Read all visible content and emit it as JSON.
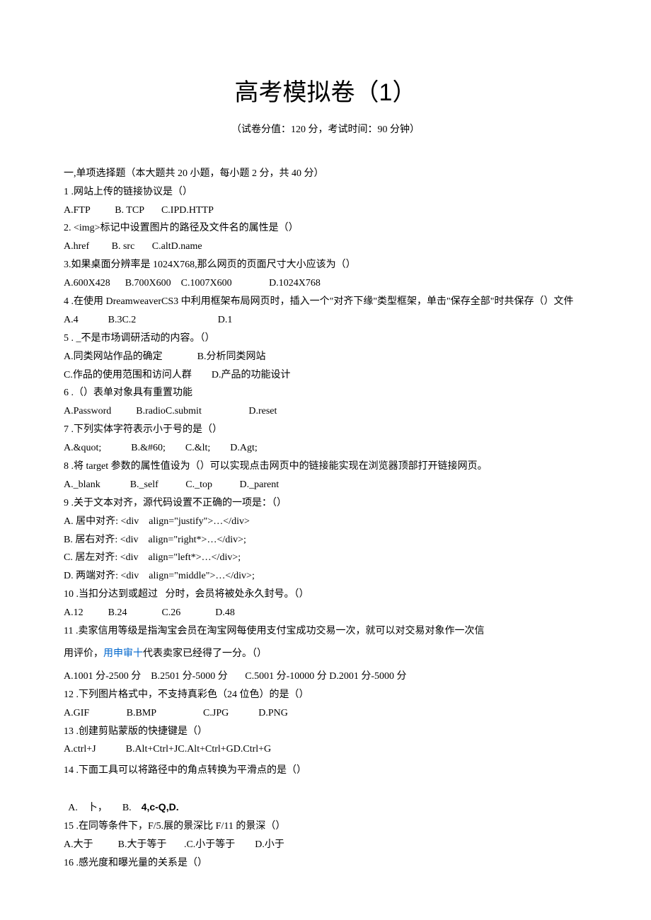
{
  "title": "高考模拟卷（1）",
  "subtitle": "（试卷分值：120 分，考试时间：90 分钟）",
  "section_header": "一,单项选择题（本大题共 20 小题，每小题 2 分，共 40 分）",
  "q1": "1 .网站上传的链接协议是（）",
  "q1_opts": "A.FTP          B. TCP       C.IPD.HTTP",
  "q2": "2. <img>标记中设置图片的路径及文件名的属性是（）",
  "q2_opts": "A.href         B. src       C.altD.name",
  "q3": "3.如果桌面分辨率是 1024X768,那么网页的页面尺寸大小应该为（）",
  "q3_opts": "A.600X428      B.700X600    C.1007X600               D.1024X768",
  "q4": "4 .在使用 DreamweaverCS3 中利用框架布局网页时，插入一个\"对齐下缘\"类型框架，单击\"保存全部\"时共保存（）文件",
  "q4_opts": "A.4            B.3C.2                                 D.1",
  "q5": "5 . _不是市场调研活动的内容。（）",
  "q5_opts1": "A.同类网站作品的确定              B.分析同类网站",
  "q5_opts2": "C.作品的使用范围和访问人群        D.产品的功能设计",
  "q6": "6 .（）表单对象具有重置功能",
  "q6_opts": "A.Password          B.radioC.submit                   D.reset",
  "q7": "7 .下列实体字符表示小于号的是（）",
  "q7_opts": "A.&quot;            B.&#60;        C.&lt;        D.Agt;",
  "q8": "8 .将 target 参数的属性值设为（）可以实现点击网页中的链接能实现在浏览器顶部打开链接网页。",
  "q8_opts": "A._blank            B._self           C._top           D._parent",
  "q9": "9 .关于文本对齐，源代码设置不正确的一项是：（）",
  "q9_a": "A. 居中对齐: <div    align=\"justify\">…</div>",
  "q9_b": "B. 居右对齐: <div    align=\"right*>…</div>;",
  "q9_c": "C. 居左对齐: <div    align=\"left*>…</div>;",
  "q9_d": "D. 两端对齐: <div    align=\"middle\">…</div>;",
  "q10": "10 .当扣分达到或超过   分时，会员将被处永久封号。（）",
  "q10_opts": "A.12          B.24              C.26              D.48",
  "q11": "11 .卖家信用等级是指淘宝会员在淘宝网每使用支付宝成功交易一次，就可以对交易对象作一次信",
  "q11b_pre": "用评价，",
  "q11b_link": "用申审十",
  "q11b_post": "代表卖家已经得了一分。（）",
  "q11_opts": "A.1001 分-2500 分    B.2501 分-5000 分       C.5001 分-10000 分 D.2001 分-5000 分",
  "q12": "12 .下列图片格式中，不支持真彩色（24 位色）的是（）",
  "q12_opts": "A.GIF               B.BMP                   C.JPG            D.PNG",
  "q13": "13 .创建剪贴蒙版的快捷键是（）",
  "q13_opts": "A.ctrl+J            B.Alt+Ctrl+JC.Alt+Ctrl+GD.Ctrl+G",
  "q14": "14 .下面工具可以将路径中的角点转换为平滑点的是（）",
  "q14_opts_a": "A.    卜，      B.    ",
  "q14_opts_b": "4,c-Q,D.",
  "q15": "15 .在同等条件下，F/5.展的景深比 F/11 的景深（）",
  "q15_opts": "A.大于          B.大于等于       .C.小于等于        D.小于",
  "q16": "16 .感光度和曝光量的关系是（）"
}
